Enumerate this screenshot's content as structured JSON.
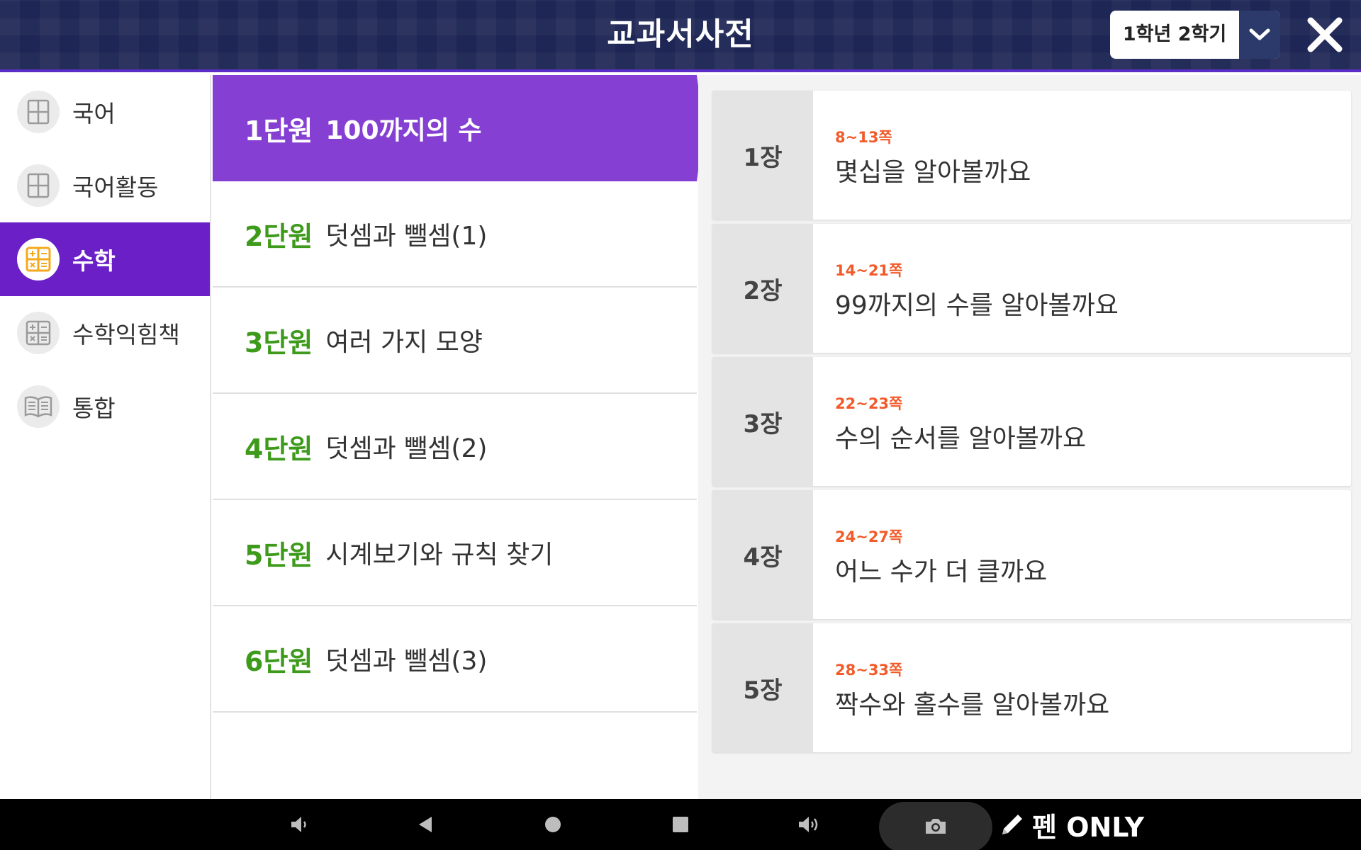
{
  "header": {
    "title": "교과서사전",
    "grade_select": "1학년 2학기"
  },
  "sidebar": {
    "items": [
      {
        "label": "국어",
        "icon": "book-grid-icon",
        "active": false
      },
      {
        "label": "국어활동",
        "icon": "book-grid-icon",
        "active": false
      },
      {
        "label": "수학",
        "icon": "calculator-icon",
        "active": true
      },
      {
        "label": "수학익힘책",
        "icon": "calculator-icon",
        "active": false
      },
      {
        "label": "통합",
        "icon": "open-book-icon",
        "active": false
      }
    ]
  },
  "units": [
    {
      "num": "1단원",
      "name": "100까지의 수",
      "active": true
    },
    {
      "num": "2단원",
      "name": "덧셈과 뺄셈(1)",
      "active": false
    },
    {
      "num": "3단원",
      "name": "여러 가지 모양",
      "active": false
    },
    {
      "num": "4단원",
      "name": "덧셈과 뺄셈(2)",
      "active": false
    },
    {
      "num": "5단원",
      "name": "시계보기와 규칙 찾기",
      "active": false
    },
    {
      "num": "6단원",
      "name": "덧셈과 뺄셈(3)",
      "active": false
    }
  ],
  "chapters": [
    {
      "no": "1장",
      "pages": "8~13쪽",
      "title": "몇십을 알아볼까요"
    },
    {
      "no": "2장",
      "pages": "14~21쪽",
      "title": "99까지의 수를 알아볼까요"
    },
    {
      "no": "3장",
      "pages": "22~23쪽",
      "title": "수의 순서를 알아볼까요"
    },
    {
      "no": "4장",
      "pages": "24~27쪽",
      "title": "어느 수가 더 클까요"
    },
    {
      "no": "5장",
      "pages": "28~33쪽",
      "title": "짝수와 홀수를 알아볼까요"
    }
  ],
  "navbar": {
    "pen_only": "펜 ONLY"
  },
  "colors": {
    "header_bg": "#1d2654",
    "active_subject": "#6a1fc7",
    "active_unit": "#8540d3",
    "unit_number": "#3d9a1b",
    "page_range": "#f25a29"
  }
}
